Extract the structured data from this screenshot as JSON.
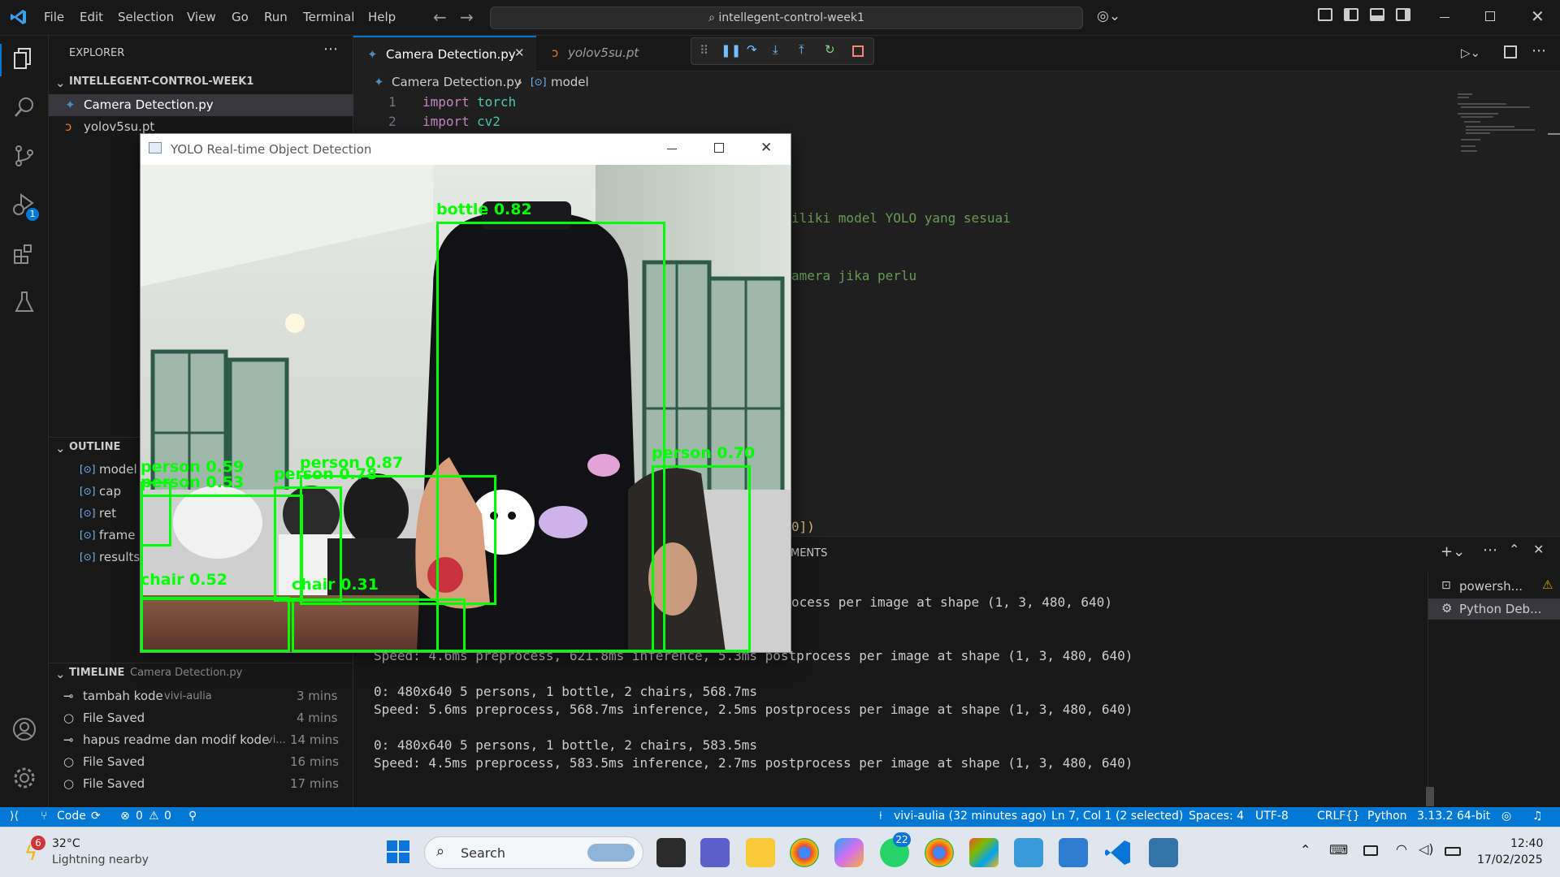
{
  "menu": [
    "File",
    "Edit",
    "Selection",
    "View",
    "Go",
    "Run",
    "Terminal",
    "Help"
  ],
  "search": {
    "text": "intellegent-control-week1"
  },
  "explorer": {
    "title": "EXPLORER",
    "folder": "INTELLEGENT-CONTROL-WEEK1",
    "files": [
      "Camera Detection.py",
      "yolov5su.pt"
    ]
  },
  "outline": {
    "title": "OUTLINE",
    "items": [
      "model",
      "cap",
      "ret",
      "frame",
      "results"
    ]
  },
  "timeline": {
    "title": "TIMELINE",
    "file": "Camera Detection.py",
    "items": [
      {
        "label": "tambah kode",
        "author": "vivi-aulia",
        "time": "3 mins"
      },
      {
        "label": "File Saved",
        "author": "",
        "time": "4 mins"
      },
      {
        "label": "hapus readme dan modif kode",
        "author": "vi...",
        "time": "14 mins"
      },
      {
        "label": "File Saved",
        "author": "",
        "time": "16 mins"
      },
      {
        "label": "File Saved",
        "author": "",
        "time": "17 mins"
      }
    ]
  },
  "tabs": [
    {
      "label": "Camera Detection.py",
      "active": true
    },
    {
      "label": "yolov5su.pt",
      "active": false
    }
  ],
  "breadcrumb": {
    "file": "Camera Detection.py",
    "symbol": "model"
  },
  "code": {
    "lines": [
      {
        "num": "1",
        "keyword": "import",
        "module": "torch"
      },
      {
        "num": "2",
        "keyword": "import",
        "module": "cv2"
      }
    ],
    "comment1": "iliki model YOLO yang sesuai",
    "comment2": "amera jika perlu",
    "fragment": "0])"
  },
  "panel": {
    "tab_fragment": "MENTS",
    "lines": [
      "ocess per image at shape (1, 3, 480, 640)",
      "Speed: 4.6ms preprocess, 621.8ms inference, 5.3ms postprocess per image at shape (1, 3, 480, 640)",
      "0: 480x640 5 persons, 1 bottle, 2 chairs, 568.7ms",
      "Speed: 5.6ms preprocess, 568.7ms inference, 2.5ms postprocess per image at shape (1, 3, 480, 640)",
      "0: 480x640 5 persons, 1 bottle, 2 chairs, 583.5ms",
      "Speed: 4.5ms preprocess, 583.5ms inference, 2.7ms postprocess per image at shape (1, 3, 480, 640)"
    ],
    "terminals": [
      "powersh...",
      "Python Deb..."
    ]
  },
  "yolo_window": {
    "title": "YOLO Real-time Object Detection",
    "detections": [
      {
        "label": "bottle 0.82"
      },
      {
        "label": "person 0.87"
      },
      {
        "label": "person 0.70"
      },
      {
        "label": "person 0.78"
      },
      {
        "label": "person 0.59"
      },
      {
        "label": "person 0.53"
      },
      {
        "label": "chair 0.52"
      },
      {
        "label": "chair 0.31"
      }
    ]
  },
  "statusbar": {
    "branch": "Code",
    "errors": "0",
    "warnings": "0",
    "blame": "vivi-aulia (32 minutes ago)",
    "position": "Ln 7, Col 1 (2 selected)",
    "spaces": "Spaces: 4",
    "encoding": "UTF-8",
    "eol": "CRLF",
    "language": "Python",
    "interpreter": "3.13.2 64-bit"
  },
  "taskbar": {
    "weather_temp": "32°C",
    "weather_desc": "Lightning nearby",
    "weather_badge": "6",
    "search_label": "Search",
    "whatsapp_badge": "22",
    "time": "12:40",
    "date": "17/02/2025"
  },
  "debug_badge": "1",
  "colors": {
    "accent": "#0078d4",
    "detection": "#00ff00",
    "keyword": "#c586c0",
    "module": "#4ec9b0",
    "comment": "#6a9955"
  }
}
